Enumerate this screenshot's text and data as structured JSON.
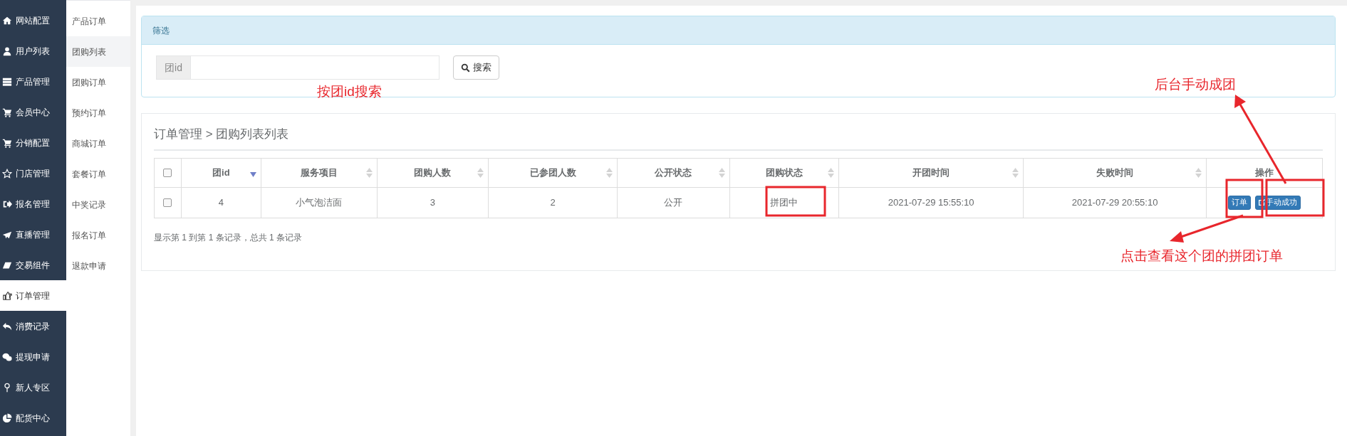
{
  "sidebar": {
    "items": [
      {
        "label": "网站配置",
        "selected": false
      },
      {
        "label": "用户列表",
        "selected": false
      },
      {
        "label": "产品管理",
        "selected": false
      },
      {
        "label": "会员中心",
        "selected": false
      },
      {
        "label": "分销配置",
        "selected": false
      },
      {
        "label": "门店管理",
        "selected": false
      },
      {
        "label": "报名管理",
        "selected": false
      },
      {
        "label": "直播管理",
        "selected": false
      },
      {
        "label": "交易组件",
        "selected": false
      },
      {
        "label": "订单管理",
        "selected": true
      },
      {
        "label": "消费记录",
        "selected": false
      },
      {
        "label": "提现申请",
        "selected": false
      },
      {
        "label": "新人专区",
        "selected": false
      },
      {
        "label": "配货中心",
        "selected": false
      }
    ]
  },
  "submenu": {
    "items": [
      {
        "label": "产品订单",
        "selected": false
      },
      {
        "label": "团购列表",
        "selected": true
      },
      {
        "label": "团购订单",
        "selected": false
      },
      {
        "label": "预约订单",
        "selected": false
      },
      {
        "label": "商城订单",
        "selected": false
      },
      {
        "label": "套餐订单",
        "selected": false
      },
      {
        "label": "中奖记录",
        "selected": false
      },
      {
        "label": "报名订单",
        "selected": false
      },
      {
        "label": "退款申请",
        "selected": false
      }
    ]
  },
  "filter": {
    "title": "筛选",
    "field_label": "团id",
    "search_button": "搜索"
  },
  "breadcrumb": "订单管理 > 团购列表列表",
  "table": {
    "all_checked": false,
    "columns": [
      {
        "label": "团id",
        "sortable": true,
        "sorted": true
      },
      {
        "label": "服务项目",
        "sortable": true,
        "sorted": false
      },
      {
        "label": "团购人数",
        "sortable": true,
        "sorted": false
      },
      {
        "label": "已参团人数",
        "sortable": true,
        "sorted": false
      },
      {
        "label": "公开状态",
        "sortable": true,
        "sorted": false
      },
      {
        "label": "团购状态",
        "sortable": true,
        "sorted": false
      },
      {
        "label": "开团时间",
        "sortable": true,
        "sorted": false
      },
      {
        "label": "失败时间",
        "sortable": true,
        "sorted": false
      },
      {
        "label": "操作",
        "sortable": false
      }
    ],
    "rows": [
      {
        "checked": false,
        "cells": [
          "4",
          "小气泡洁面",
          "3",
          "2",
          "公开",
          "拼团中",
          "2021-07-29 15:55:10",
          "2021-07-29 20:55:10"
        ],
        "actions": [
          "订单",
          "手动成功"
        ]
      }
    ]
  },
  "pagination_info": "显示第 1 到第 1 条记录，总共 1 条记录",
  "annotations": [
    {
      "kind": "note",
      "text": "按团id搜索"
    },
    {
      "kind": "note",
      "text": "后台手动成团"
    },
    {
      "kind": "note",
      "text": "点击查看这个团的拼团订单"
    }
  ]
}
